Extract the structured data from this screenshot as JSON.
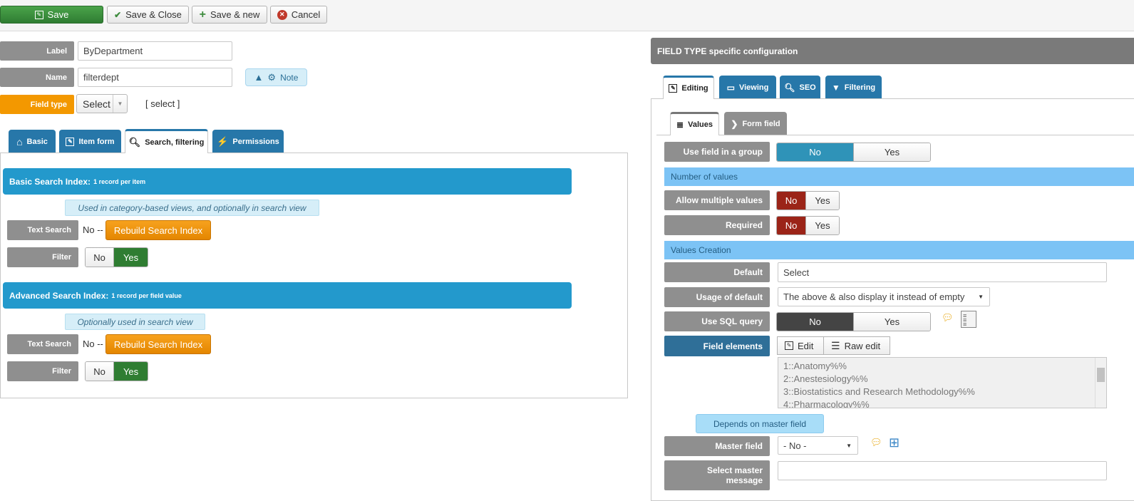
{
  "toolbar": {
    "save": "Save",
    "save_close": "Save & Close",
    "save_new": "Save & new",
    "cancel": "Cancel"
  },
  "form": {
    "label_label": "Label",
    "label_value": "ByDepartment",
    "name_label": "Name",
    "name_value": "filterdept",
    "note_button": "Note",
    "field_type_label": "Field type",
    "field_type_value": "Select",
    "field_type_text": "[ select ]"
  },
  "left_tabs": [
    "Basic",
    "Item form",
    "Search, filtering",
    "Permissions"
  ],
  "basic_index": {
    "title": "Basic Search Index:",
    "subtitle": "1 record per item",
    "note": "Used in category-based views, and optionally in search view",
    "text_search_label": "Text Search",
    "text_search_value": "No --",
    "rebuild": "Rebuild Search Index",
    "filter_label": "Filter",
    "no": "No",
    "yes": "Yes"
  },
  "adv_index": {
    "title": "Advanced Search Index:",
    "subtitle": "1 record per field value",
    "note": "Optionally used in search view",
    "text_search_label": "Text Search",
    "text_search_value": "No --",
    "rebuild": "Rebuild Search Index",
    "filter_label": "Filter",
    "no": "No",
    "yes": "Yes"
  },
  "right": {
    "header": "FIELD TYPE specific configuration",
    "tabs": [
      "Editing",
      "Viewing",
      "SEO",
      "Filtering"
    ],
    "subtabs": [
      "Values",
      "Form field"
    ],
    "use_group_label": "Use field in a group",
    "use_group_no": "No",
    "use_group_yes": "Yes",
    "number_of_values": "Number of values",
    "allow_multiple_label": "Allow multiple values",
    "required_label": "Required",
    "no": "No",
    "yes": "Yes",
    "values_creation": "Values Creation",
    "default_label": "Default",
    "default_value": "Select",
    "usage_label": "Usage of default",
    "usage_value": "The above & also display it instead of empty",
    "sql_label": "Use SQL query",
    "sql_no": "No",
    "sql_yes": "Yes",
    "elements_label": "Field elements",
    "edit_btn": "Edit",
    "raw_edit_btn": "Raw edit",
    "elements_text": "1::Anatomy%%\n2::Anestesiology%%\n3::Biostatistics and Research Methodology%%\n4::Pharmacology%%",
    "depends": "Depends on master field",
    "master_label": "Master field",
    "master_value": "- No -",
    "select_master_label_1": "Select master",
    "select_master_label_2": "message"
  },
  "colors": {
    "save_green": "#2f7d32",
    "tab_blue": "#2777a9",
    "section_blue": "#2399cc",
    "field_type_orange": "#f39800",
    "no_red": "#9b2418"
  }
}
